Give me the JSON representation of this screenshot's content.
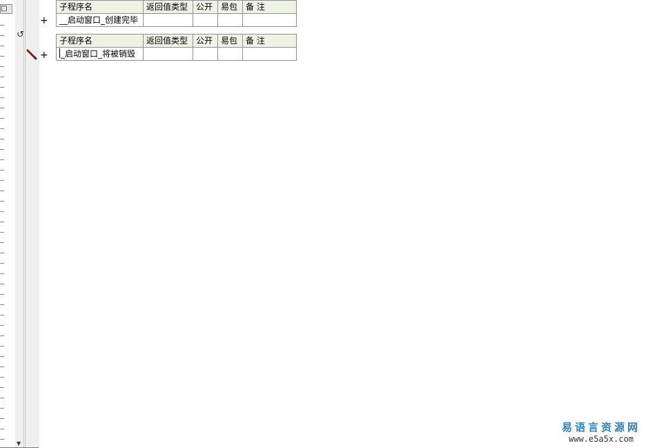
{
  "tables": [
    {
      "headers": [
        "子程序名",
        "返回值类型",
        "公开",
        "易包",
        "备 注"
      ],
      "row": [
        "__启动窗口_创建完毕",
        "",
        "",
        "",
        ""
      ]
    },
    {
      "headers": [
        "子程序名",
        "返回值类型",
        "公开",
        "易包",
        "备 注"
      ],
      "row": [
        "_启动窗口_将被销毁",
        "",
        "",
        "",
        ""
      ]
    }
  ],
  "gutter": {
    "plus": "+"
  },
  "watermark": {
    "title": "易语言资源网",
    "url": "www.e5a5x.com"
  },
  "colors": {
    "header_bg": "#eef3e6",
    "grid": "#909090",
    "watermark": "#2d7fbf"
  },
  "icons": [
    "pencil-icon",
    "toggle-icon",
    "scroll-down-arrow-icon"
  ]
}
